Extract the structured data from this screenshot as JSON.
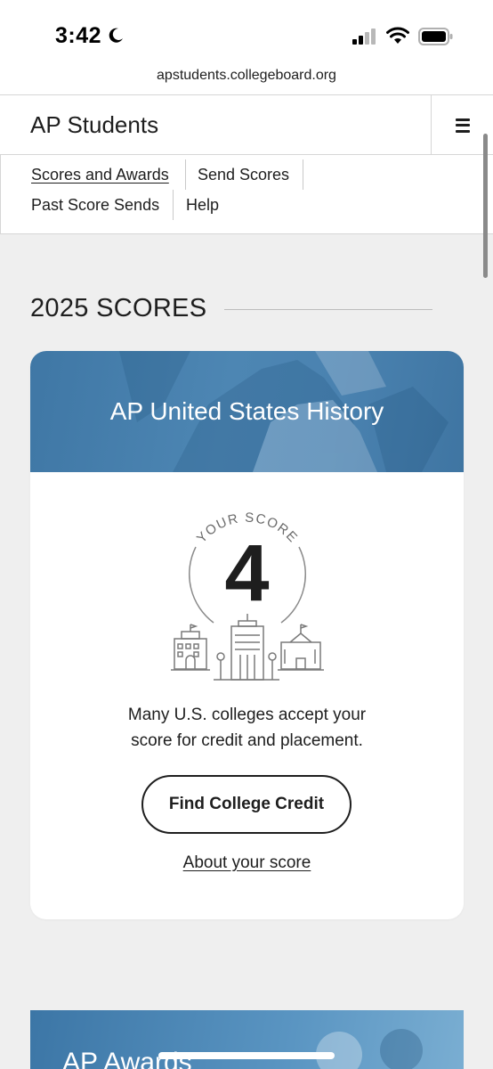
{
  "status_bar": {
    "time": "3:42"
  },
  "browser": {
    "url": "apstudents.collegeboard.org"
  },
  "header": {
    "title": "AP Students"
  },
  "sub_nav": {
    "items": [
      {
        "label": "Scores and Awards",
        "active": true
      },
      {
        "label": "Send Scores",
        "active": false
      },
      {
        "label": "Past Score Sends",
        "active": false
      },
      {
        "label": "Help",
        "active": false
      }
    ]
  },
  "section": {
    "heading": "2025 SCORES"
  },
  "score_card": {
    "subject": "AP United States History",
    "score_caption": "YOUR SCORE",
    "score": "4",
    "message_line1": "Many U.S. colleges accept your",
    "message_line2": "score for credit and placement.",
    "button_label": "Find College Credit",
    "link_label": "About your score"
  },
  "awards_card": {
    "title": "AP Awards"
  },
  "colors": {
    "banner_blue": "#4a82b0",
    "page_bg": "#efefef",
    "text": "#1e1e1e"
  }
}
